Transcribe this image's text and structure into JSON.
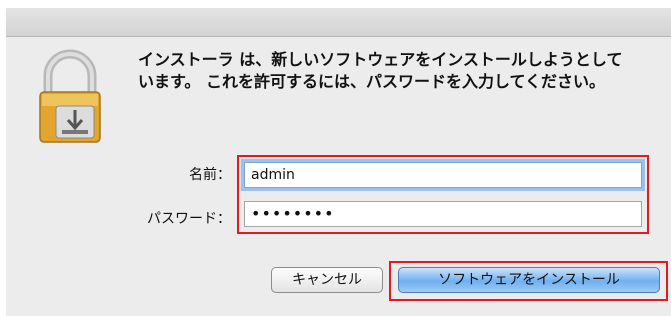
{
  "dialog": {
    "message": "インストーラ は、新しいソフトウェアをインストールしようとしています。 これを許可するには、パスワードを入力してください。",
    "icon": "padlock-with-install-disk-icon"
  },
  "fields": {
    "name_label": "名前：",
    "name_value": "admin",
    "password_label": "パスワード：",
    "password_value": "••••••••"
  },
  "buttons": {
    "cancel": "キャンセル",
    "install": "ソフトウェアをインストール"
  },
  "colors": {
    "highlight": "#e21b23",
    "focus_ring": "#9cc1ee",
    "primary_button": "#6fb0f0"
  }
}
